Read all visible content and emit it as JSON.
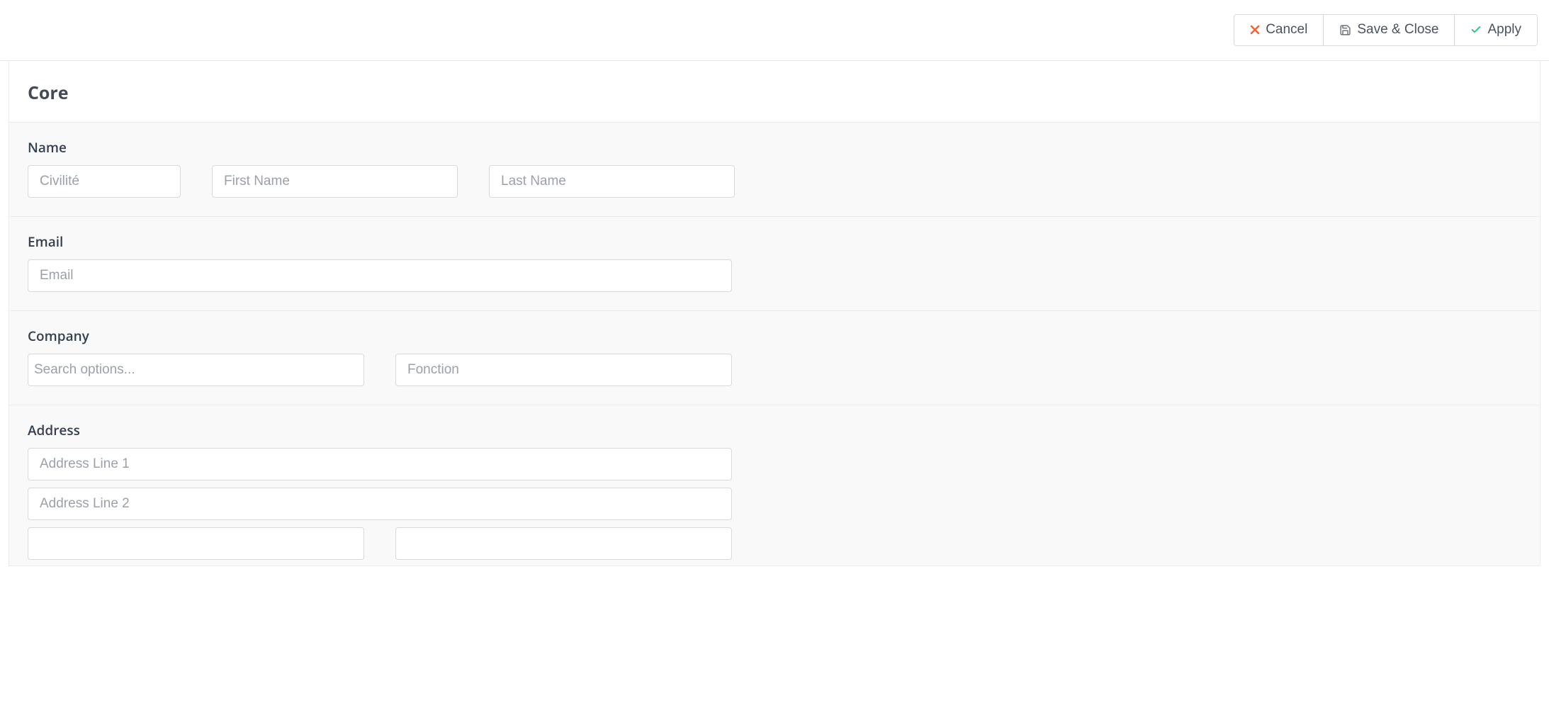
{
  "actions": {
    "cancel": "Cancel",
    "save_and_close": "Save & Close",
    "apply": "Apply"
  },
  "panel": {
    "title": "Core"
  },
  "sections": {
    "name": {
      "label": "Name",
      "civilite_placeholder": "Civilité",
      "first_name_placeholder": "First Name",
      "last_name_placeholder": "Last Name"
    },
    "email": {
      "label": "Email",
      "placeholder": "Email"
    },
    "company": {
      "label": "Company",
      "search_placeholder": "Search options...",
      "fonction_placeholder": "Fonction"
    },
    "address": {
      "label": "Address",
      "line1_placeholder": "Address Line 1",
      "line2_placeholder": "Address Line 2"
    }
  }
}
